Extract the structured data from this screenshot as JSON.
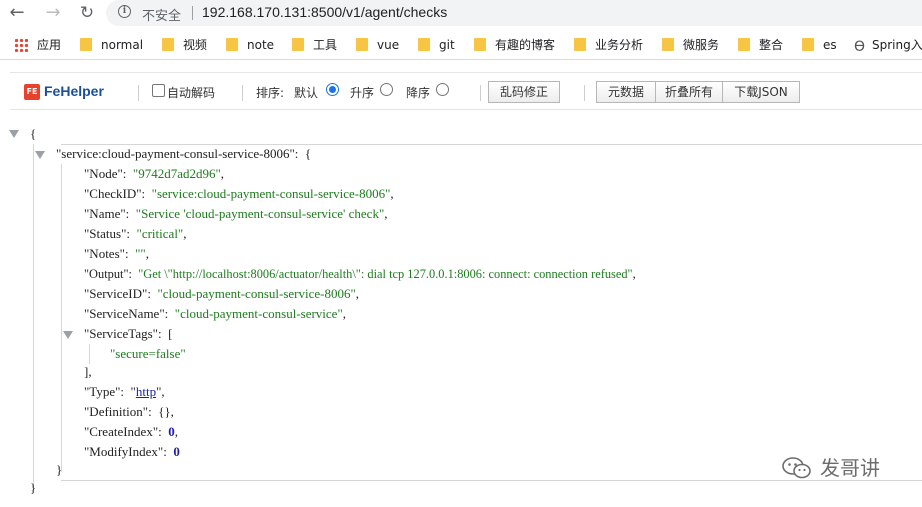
{
  "browser": {
    "back_icon": "arrow-left-icon",
    "forward_icon": "arrow-right-icon",
    "reload_icon": "reload-icon",
    "security_label": "不安全",
    "url": "192.168.170.131:8500/v1/agent/checks"
  },
  "bookmarks": [
    {
      "label": "应用",
      "icon": "apps-icon"
    },
    {
      "label": "normal",
      "icon": "folder-icon"
    },
    {
      "label": "视频",
      "icon": "folder-icon"
    },
    {
      "label": "note",
      "icon": "folder-icon"
    },
    {
      "label": "工具",
      "icon": "folder-icon"
    },
    {
      "label": "vue",
      "icon": "folder-icon"
    },
    {
      "label": "git",
      "icon": "folder-icon"
    },
    {
      "label": "有趣的博客",
      "icon": "folder-icon"
    },
    {
      "label": "业务分析",
      "icon": "folder-icon"
    },
    {
      "label": "微服务",
      "icon": "folder-icon"
    },
    {
      "label": "整合",
      "icon": "folder-icon"
    },
    {
      "label": "es",
      "icon": "folder-icon"
    },
    {
      "label": "Spring入",
      "icon": "spring-icon"
    }
  ],
  "fehelper": {
    "title": "FeHelper",
    "auto_decode_label": "自动解码",
    "sort_label": "排序:",
    "sort_options": [
      "默认",
      "升序",
      "降序"
    ],
    "sort_selected": "默认",
    "fix_button": "乱码修正",
    "buttons": [
      "元数据",
      "折叠所有",
      "下载JSON"
    ]
  },
  "json": {
    "open_brace": "{",
    "close_brace": "}",
    "check_key": "\"service:cloud-payment-consul-service-8006\"",
    "fields": [
      {
        "key": "\"Node\"",
        "value": "\"9742d7ad2d96\"",
        "type": "string"
      },
      {
        "key": "\"CheckID\"",
        "value": "\"service:cloud-payment-consul-service-8006\"",
        "type": "string"
      },
      {
        "key": "\"Name\"",
        "value": "\"Service 'cloud-payment-consul-service' check\"",
        "type": "string"
      },
      {
        "key": "\"Status\"",
        "value": "\"critical\"",
        "type": "string"
      },
      {
        "key": "\"Notes\"",
        "value": "\"\"",
        "type": "string"
      },
      {
        "key": "\"Output\"",
        "value": "\"Get \\\"http://localhost:8006/actuator/health\\\": dial tcp 127.0.0.1:8006: connect: connection refused\"",
        "type": "string"
      },
      {
        "key": "\"ServiceID\"",
        "value": "\"cloud-payment-consul-service-8006\"",
        "type": "string"
      },
      {
        "key": "\"ServiceName\"",
        "value": "\"cloud-payment-consul-service\"",
        "type": "string"
      }
    ],
    "service_tags_key": "\"ServiceTags\"",
    "service_tags": [
      "\"secure=false\""
    ],
    "fields_after": [
      {
        "key": "\"Type\"",
        "value": "\"http\"",
        "type": "link"
      },
      {
        "key": "\"Definition\"",
        "value": "{}",
        "type": "object"
      },
      {
        "key": "\"CreateIndex\"",
        "value": "0",
        "type": "number"
      },
      {
        "key": "\"ModifyIndex\"",
        "value": "0",
        "type": "number"
      }
    ]
  },
  "watermark": {
    "text": "发哥讲",
    "icon": "wechat-icon"
  }
}
